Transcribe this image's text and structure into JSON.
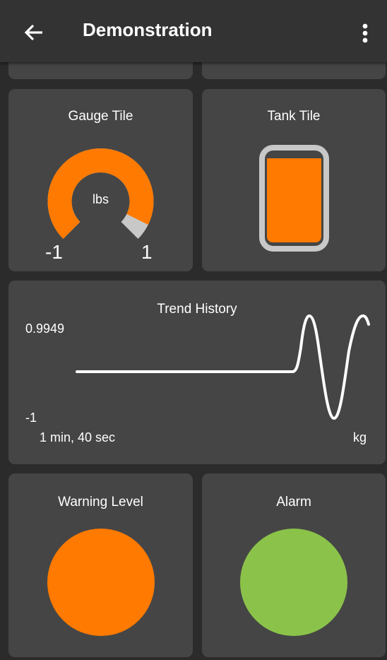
{
  "app_bar": {
    "title": "Demonstration",
    "back_icon": "arrow-left-icon",
    "menu_icon": "more-vert-icon"
  },
  "gauge_tile": {
    "title": "Gauge Tile",
    "unit": "lbs",
    "min_label": "-1",
    "max_label": "1",
    "fill_fraction": 0.93,
    "fill_color": "#ff7a00",
    "track_color": "#c8c8c8"
  },
  "tank_tile": {
    "title": "Tank Tile",
    "fill_fraction": 0.95,
    "fill_color": "#ff7a00",
    "frame_color": "#c8c8c8"
  },
  "trend_tile": {
    "title": "Trend History",
    "max_label": "0.9949",
    "min_label": "-1",
    "time_label": "1 min, 40 sec",
    "unit": "kg"
  },
  "warning_tile": {
    "title": "Warning Level",
    "color": "#ff7a00"
  },
  "alarm_tile": {
    "title": "Alarm",
    "color": "#8bc34a"
  }
}
